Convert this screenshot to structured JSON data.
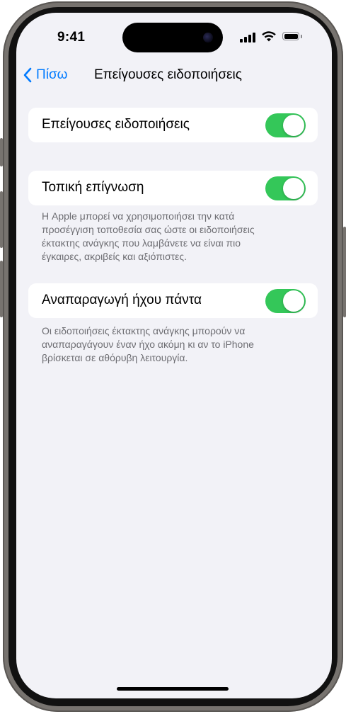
{
  "status_bar": {
    "time": "9:41"
  },
  "nav": {
    "back_label": "Πίσω",
    "title": "Επείγουσες ειδοποιήσεις"
  },
  "settings": [
    {
      "label": "Επείγουσες ειδοποιήσεις",
      "on": true,
      "footer": ""
    },
    {
      "label": "Τοπική επίγνωση",
      "on": true,
      "footer_lines": [
        "Η Apple μπορεί να χρησιμοποιήσει την κατά",
        "προσέγγιση τοποθεσία σας ώστε οι ειδοποιήσεις",
        "έκτακτης ανάγκης που λαμβάνετε να είναι πιο",
        "έγκαιρες, ακριβείς και αξιόπιστες."
      ]
    },
    {
      "label": "Αναπαραγωγή ήχου πάντα",
      "on": true,
      "footer_lines": [
        "Οι ειδοποιήσεις έκτακτης ανάγκης μπορούν να",
        "αναπαραγάγουν έναν ήχο ακόμη κι αν το iPhone",
        "βρίσκεται σε αθόρυβη λειτουργία."
      ]
    }
  ],
  "colors": {
    "accent": "#007aff",
    "toggle_on": "#34c759",
    "background": "#f2f2f7",
    "footnote": "#6d6d72"
  },
  "icons": {
    "back": "chevron-left-icon",
    "signal": "cellular-signal-icon",
    "wifi": "wifi-icon",
    "battery": "battery-icon"
  }
}
